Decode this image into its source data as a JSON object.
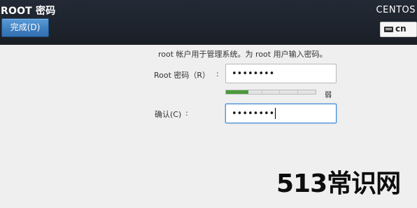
{
  "header": {
    "title": "ROOT 密码",
    "done_button": "完成(D)",
    "product": "CENTOS",
    "keyboard": {
      "icon": "keyboard-icon",
      "layout": "cn"
    }
  },
  "form": {
    "intro": "root 帐户用于管理系统。为 root 用户输入密码。",
    "separator": ":",
    "password": {
      "label": "Root 密码（R）",
      "value": "••••••••"
    },
    "strength": {
      "text": "弱",
      "level": 0.25,
      "segments": 5,
      "color": "#4c9a3a"
    },
    "confirm": {
      "label": "确认(C)",
      "value": "••••••••"
    }
  },
  "watermark": "513常识网"
}
